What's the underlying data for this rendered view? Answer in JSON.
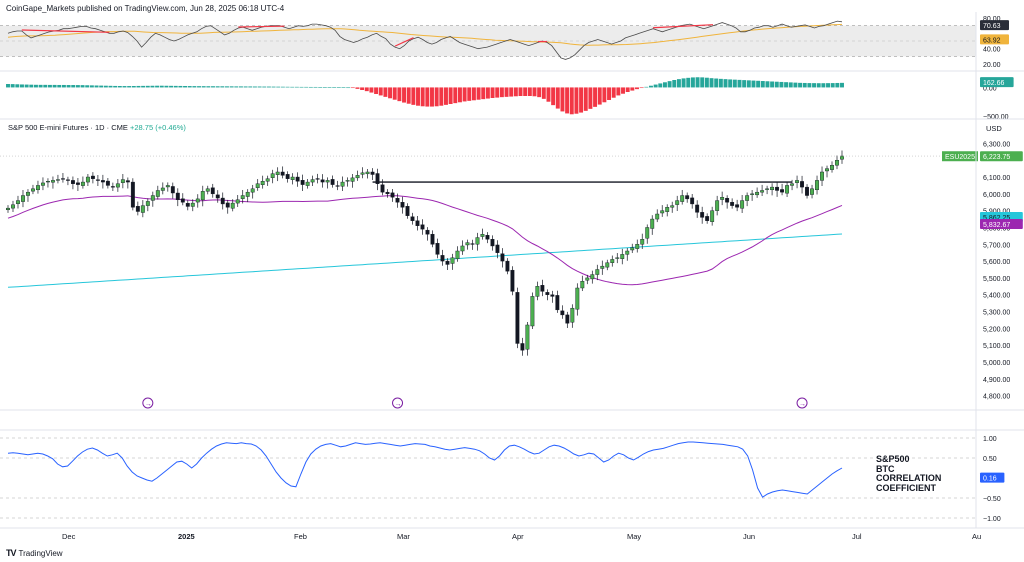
{
  "header": {
    "publisher": "CoinGape_Markets published on TradingView.com, Jun 28, 2025 06:18 UTC-4"
  },
  "symbol": {
    "title": "S&P 500 E-mini Futures · 1D · CME",
    "change": "+28.75 (+0.46%)",
    "currency": "USD",
    "ticker_badge": "ESU2025"
  },
  "correlation_label": [
    "S&P500",
    "BTC",
    "CORRELATION",
    "COEFFICIENT"
  ],
  "brand": {
    "name": "TradingView",
    "logo_text": "TV"
  },
  "colors": {
    "bull": "#4caf50",
    "bear": "#131722",
    "ma_fast": "#9c27b0",
    "ma_slow": "#26c6da",
    "rsi_line": "#4a4a4a",
    "rsi_ma": "#f0b43c",
    "hist_pos": "#26a69a",
    "hist_neg": "#f23645",
    "corr_line": "#2962ff",
    "divergence": "#f23645"
  },
  "chart_data": [
    {
      "type": "line",
      "name": "RSI panel",
      "yaxis_ticks": [
        "80.00",
        "40.00",
        "20.00"
      ],
      "ylim": [
        20,
        80
      ],
      "series": [
        {
          "values": [
            60,
            62,
            63,
            63,
            58,
            54,
            56,
            58,
            60,
            62,
            63,
            64,
            66,
            66,
            67,
            68,
            69,
            69,
            67,
            66,
            64,
            62,
            60,
            60,
            62,
            63,
            61,
            56,
            50,
            42,
            48,
            55,
            60,
            58,
            55,
            52,
            50,
            52,
            55,
            58,
            60,
            62,
            66,
            69,
            70,
            66,
            62,
            58,
            60,
            64,
            67,
            68,
            66,
            64,
            66,
            68,
            69,
            70,
            70,
            70,
            68,
            66,
            68,
            70,
            69,
            70,
            72,
            72,
            71,
            70,
            68,
            64,
            56,
            52,
            50,
            48,
            50,
            53,
            55,
            58,
            60,
            56,
            53,
            46,
            42,
            40,
            44,
            50,
            53,
            55,
            52,
            48,
            46,
            48,
            52,
            54,
            56,
            52,
            48,
            46,
            44,
            42,
            40,
            41,
            42,
            44,
            46,
            48,
            50,
            52,
            50,
            48,
            46,
            44,
            46,
            48,
            50,
            48,
            44,
            36,
            28,
            26,
            28,
            32,
            38,
            44,
            48,
            50,
            52,
            50,
            48,
            46,
            48,
            50,
            54,
            56,
            58,
            60,
            62,
            64,
            66,
            64,
            62,
            64,
            66,
            68,
            70,
            71,
            72,
            70,
            68,
            66,
            68,
            70,
            72,
            74,
            72,
            70,
            67,
            62,
            62,
            64,
            67,
            68,
            70,
            70,
            68,
            70,
            72,
            70,
            68,
            69,
            70,
            71,
            69,
            67,
            69,
            70,
            72,
            74,
            76,
            75
          ]
        },
        {
          "values": [
            55,
            55.5,
            56,
            56.4,
            56.6,
            56.6,
            56.7,
            56.8,
            57,
            57.3,
            57.6,
            58,
            58.4,
            58.8,
            59.3,
            59.8,
            60.3,
            60.8,
            61.2,
            61.6,
            61.9,
            62.1,
            62.2,
            62.3,
            62.5,
            62.7,
            62.8,
            62.6,
            62.3,
            61.7,
            61.3,
            61.1,
            61,
            60.9,
            60.8,
            60.6,
            60.4,
            60.2,
            60.1,
            60.1,
            60.1,
            60.2,
            60.5,
            60.8,
            61.2,
            61.4,
            61.5,
            61.6,
            61.7,
            61.9,
            62.1,
            62.4,
            62.6,
            62.8,
            63,
            63.2,
            63.4,
            63.7,
            64,
            64.2,
            64.4,
            64.6,
            64.8,
            65,
            65.2,
            65.4,
            65.6,
            65.8,
            66,
            66.1,
            66.1,
            66,
            65.6,
            65.1,
            64.6,
            64,
            63.5,
            63.1,
            62.7,
            62.3,
            61.9,
            61.5,
            61.1,
            60.5,
            59.8,
            59.1,
            58.5,
            58,
            57.5,
            57.1,
            56.7,
            56.2,
            55.7,
            55.3,
            55,
            54.8,
            54.6,
            54.3,
            53.9,
            53.5,
            53,
            52.5,
            52,
            51.5,
            51.1,
            50.8,
            50.5,
            50.3,
            50.1,
            49.9,
            49.7,
            49.4,
            49.1,
            48.9,
            48.7,
            48.6,
            48.4,
            48.1,
            47.6,
            46.9,
            46.1,
            45.4,
            44.9,
            44.6,
            44.5,
            44.6,
            44.7,
            44.9,
            45,
            45.1,
            45.2,
            45.3,
            45.5,
            45.8,
            46.1,
            46.5,
            47,
            47.5,
            48.1,
            48.8,
            49.5,
            50.2,
            50.9,
            51.7,
            52.5,
            53.3,
            54.1,
            55,
            55.9,
            56.7,
            57.5,
            58.3,
            59.1,
            59.9,
            60.7,
            61.5,
            62.3,
            63,
            63.7,
            64.3,
            64.9,
            65.5,
            66,
            66.5,
            67,
            67.4,
            67.8,
            68.2,
            68.6,
            69,
            69.3,
            69.6,
            69.9,
            70.2,
            70.5,
            70.8,
            71.1,
            71.4,
            71.7
          ]
        }
      ],
      "last_labels": [
        "70.63",
        "63.92"
      ]
    },
    {
      "type": "bar",
      "name": "Momentum histogram",
      "yaxis_ticks": [
        "0.00",
        "−500.00"
      ],
      "ylim": [
        -500,
        200
      ],
      "values": [
        60,
        58,
        55,
        52,
        50,
        48,
        46,
        45,
        45,
        44,
        44,
        43,
        43,
        42,
        42,
        41,
        40,
        38,
        36,
        34,
        32,
        30,
        28,
        26,
        25,
        24,
        24,
        25,
        26,
        27,
        28,
        29,
        30,
        30,
        29,
        28,
        27,
        26,
        25,
        24,
        23,
        22,
        22,
        21,
        21,
        20,
        20,
        19,
        19,
        18,
        18,
        17,
        17,
        16,
        16,
        15,
        15,
        14,
        13,
        12,
        11,
        10,
        10,
        9,
        9,
        8,
        8,
        7,
        7,
        6,
        5,
        4,
        2,
        0,
        -10,
        -25,
        -45,
        -65,
        -90,
        -115,
        -140,
        -165,
        -190,
        -215,
        -240,
        -265,
        -285,
        -305,
        -320,
        -330,
        -335,
        -335,
        -330,
        -320,
        -305,
        -290,
        -275,
        -260,
        -245,
        -235,
        -225,
        -215,
        -205,
        -195,
        -185,
        -178,
        -170,
        -165,
        -160,
        -155,
        -150,
        -150,
        -150,
        -155,
        -170,
        -200,
        -250,
        -310,
        -370,
        -420,
        -455,
        -470,
        -460,
        -440,
        -410,
        -375,
        -340,
        -300,
        -260,
        -220,
        -180,
        -140,
        -110,
        -80,
        -55,
        -30,
        -10,
        10,
        30,
        50,
        70,
        90,
        110,
        130,
        145,
        158,
        168,
        175,
        178,
        176,
        170,
        162,
        156,
        150,
        145,
        140,
        136,
        132,
        128,
        124,
        120,
        116,
        112,
        108,
        104,
        100,
        96,
        92,
        88,
        84,
        80,
        78,
        76,
        75,
        74,
        74,
        75,
        76,
        78,
        80
      ],
      "last_label": "162.66"
    },
    {
      "type": "candlestick",
      "name": "S&P 500 E-mini Futures · 1D · CME",
      "yaxis_ticks": [
        "6,300.00",
        "6,100.00",
        "6,000.00",
        "5,900.00",
        "5,800.00",
        "5,700.00",
        "5,600.00",
        "5,500.00",
        "5,400.00",
        "5,300.00",
        "5,200.00",
        "5,100.00",
        "5,000.00",
        "4,900.00",
        "4,800.00"
      ],
      "ylim": [
        4750,
        6350
      ],
      "closes": [
        5915,
        5935,
        5960,
        5990,
        6010,
        6030,
        6050,
        6065,
        6075,
        6080,
        6085,
        6090,
        6080,
        6060,
        6055,
        6070,
        6100,
        6090,
        6080,
        6070,
        6050,
        6040,
        6060,
        6085,
        6070,
        5920,
        5895,
        5930,
        5955,
        5990,
        6020,
        6035,
        6050,
        6005,
        5965,
        5950,
        5925,
        5945,
        5970,
        6015,
        6030,
        6000,
        5975,
        5940,
        5920,
        5945,
        5965,
        5990,
        6010,
        6030,
        6060,
        6075,
        6090,
        6120,
        6130,
        6110,
        6090,
        6100,
        6075,
        6055,
        6070,
        6085,
        6090,
        6070,
        6080,
        6055,
        6045,
        6070,
        6080,
        6095,
        6110,
        6125,
        6130,
        6115,
        6060,
        6010,
        6000,
        5980,
        5950,
        5920,
        5870,
        5840,
        5810,
        5790,
        5760,
        5700,
        5640,
        5600,
        5580,
        5620,
        5660,
        5690,
        5710,
        5700,
        5740,
        5760,
        5730,
        5690,
        5650,
        5600,
        5540,
        5420,
        5110,
        5070,
        5220,
        5390,
        5450,
        5420,
        5400,
        5390,
        5310,
        5280,
        5230,
        5320,
        5440,
        5480,
        5500,
        5520,
        5550,
        5570,
        5590,
        5610,
        5620,
        5640,
        5660,
        5680,
        5700,
        5730,
        5800,
        5850,
        5880,
        5900,
        5920,
        5930,
        5960,
        5990,
        5970,
        5940,
        5890,
        5860,
        5840,
        5900,
        5960,
        5980,
        5950,
        5930,
        5920,
        5960,
        5990,
        6000,
        6010,
        6020,
        6030,
        6040,
        6020,
        6010,
        6050,
        6060,
        6080,
        6040,
        5990,
        6030,
        6080,
        6130,
        6150,
        6170,
        6200,
        6225
      ],
      "ma_fast_last": 5832.67,
      "ma_slow_last": 5862.25,
      "resistance_level": 6070,
      "last_labels": [
        "6,223.75",
        "5,862.25",
        "5,832.67"
      ]
    },
    {
      "type": "line",
      "name": "S&P500 BTC CORRELATION COEFFICIENT",
      "yaxis_ticks": [
        "1.00",
        "0.50",
        "−0.50",
        "−1.00"
      ],
      "ylim": [
        -1,
        1
      ],
      "values": [
        0.62,
        0.63,
        0.62,
        0.6,
        0.58,
        0.6,
        0.62,
        0.6,
        0.55,
        0.48,
        0.35,
        0.28,
        0.3,
        0.42,
        0.55,
        0.65,
        0.72,
        0.75,
        0.7,
        0.62,
        0.55,
        0.58,
        0.62,
        0.5,
        0.3,
        0.15,
        0.05,
        0.0,
        -0.05,
        -0.08,
        0.0,
        0.1,
        0.2,
        0.3,
        0.4,
        0.42,
        0.35,
        0.25,
        0.35,
        0.5,
        0.62,
        0.72,
        0.8,
        0.85,
        0.88,
        0.87,
        0.86,
        0.88,
        0.86,
        0.85,
        0.8,
        0.7,
        0.55,
        0.35,
        0.15,
        0.0,
        -0.12,
        -0.2,
        -0.22,
        0.1,
        0.4,
        0.6,
        0.72,
        0.8,
        0.84,
        0.86,
        0.82,
        0.78,
        0.8,
        0.84,
        0.88,
        0.86,
        0.84,
        0.85,
        0.87,
        0.88,
        0.86,
        0.84,
        0.82,
        0.8,
        0.82,
        0.84,
        0.86,
        0.85,
        0.84,
        0.8,
        0.78,
        0.75,
        0.72,
        0.7,
        0.72,
        0.74,
        0.76,
        0.74,
        0.72,
        0.68,
        0.6,
        0.5,
        0.45,
        0.55,
        0.7,
        0.8,
        0.82,
        0.78,
        0.72,
        0.65,
        0.6,
        0.62,
        0.7,
        0.78,
        0.82,
        0.8,
        0.75,
        0.68,
        0.6,
        0.55,
        0.58,
        0.62,
        0.6,
        0.5,
        0.4,
        0.45,
        0.55,
        0.62,
        0.58,
        0.5,
        0.45,
        0.52,
        0.6,
        0.66,
        0.7,
        0.72,
        0.74,
        0.78,
        0.82,
        0.86,
        0.88,
        0.9,
        0.9,
        0.89,
        0.88,
        0.87,
        0.86,
        0.85,
        0.84,
        0.82,
        0.8,
        0.78,
        0.72,
        0.55,
        0.2,
        -0.25,
        -0.48,
        -0.4,
        -0.35,
        -0.32,
        -0.3,
        -0.32,
        -0.34,
        -0.36,
        -0.38,
        -0.4,
        -0.3,
        -0.2,
        -0.1,
        0.0,
        0.1,
        0.18,
        0.25
      ],
      "last_label": "0.16"
    }
  ],
  "xaxis_labels": [
    "Dec",
    "2025",
    "Feb",
    "Mar",
    "Apr",
    "May",
    "Jun",
    "Jul",
    "Au"
  ]
}
